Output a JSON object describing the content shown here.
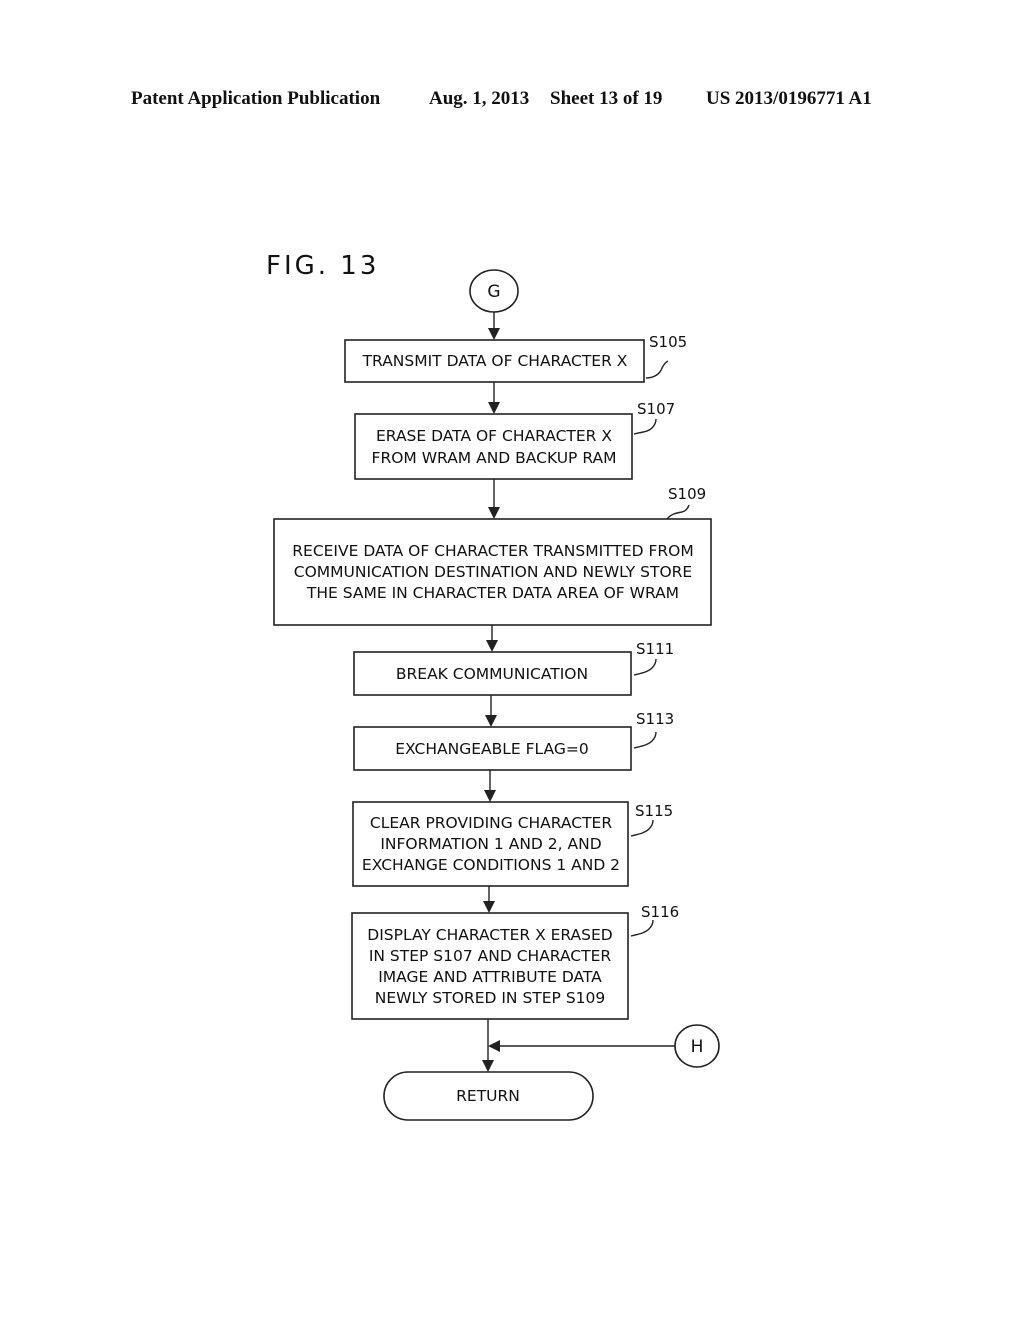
{
  "header": {
    "publication": "Patent Application Publication",
    "date": "Aug. 1, 2013",
    "sheet": "Sheet 13 of 19",
    "number": "US 2013/0196771 A1"
  },
  "figure": {
    "label": "FIG. 13",
    "start_connector": "G",
    "merge_connector": "H",
    "end_terminal": "RETURN",
    "steps": [
      {
        "id": "S105",
        "lines": [
          "TRANSMIT DATA OF CHARACTER X"
        ]
      },
      {
        "id": "S107",
        "lines": [
          "ERASE DATA OF CHARACTER X",
          "FROM WRAM AND BACKUP RAM"
        ]
      },
      {
        "id": "S109",
        "lines": [
          "RECEIVE DATA OF CHARACTER TRANSMITTED FROM",
          "COMMUNICATION DESTINATION AND  NEWLY STORE",
          "THE SAME IN CHARACTER DATA AREA OF WRAM"
        ]
      },
      {
        "id": "S111",
        "lines": [
          "BREAK COMMUNICATION"
        ]
      },
      {
        "id": "S113",
        "lines": [
          "EXCHANGEABLE FLAG=0"
        ]
      },
      {
        "id": "S115",
        "lines": [
          "CLEAR PROVIDING CHARACTER",
          "INFORMATION 1 AND 2, AND",
          "EXCHANGE CONDITIONS 1 AND 2"
        ]
      },
      {
        "id": "S116",
        "lines": [
          "DISPLAY CHARACTER X ERASED",
          "IN STEP S107 AND CHARACTER",
          "IMAGE AND ATTRIBUTE DATA",
          "NEWLY STORED IN STEP S109"
        ]
      }
    ]
  }
}
